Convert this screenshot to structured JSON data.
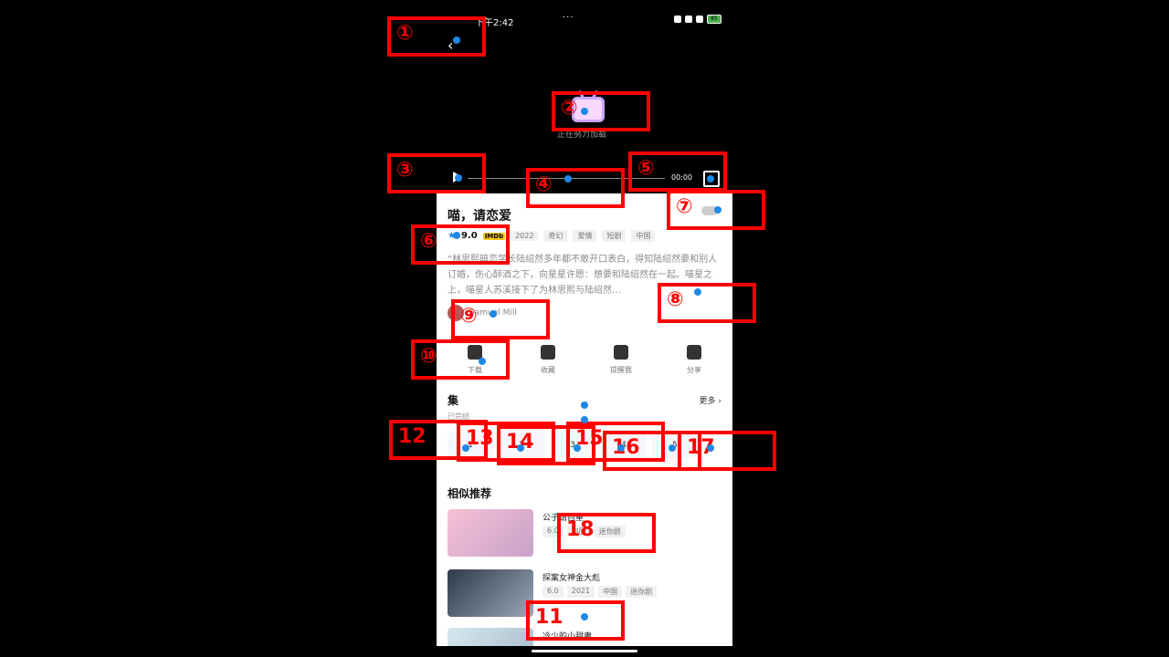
{
  "status": {
    "time": "下午2:42",
    "dots": "···",
    "battery": "85"
  },
  "player": {
    "loading_text": "正在努力加载",
    "time_total": "00:00"
  },
  "content": {
    "title": "喵，请恋爱",
    "rating": "9.0",
    "imdb": "IMDb",
    "tags": [
      "2022",
      "奇幻",
      "爱情",
      "短剧",
      "中国"
    ],
    "description": "“林思熙暗恋学长陆绍然多年都不敢开口表白，得知陆绍然要和别人订婚，伤心醉酒之下，向星星许愿：想要和陆绍然在一起。喵星之上，喵星人苏溪接下了为林思熙与陆绍然…",
    "actor": "Samuel Mill"
  },
  "actions": [
    {
      "label": "下载"
    },
    {
      "label": "收藏"
    },
    {
      "label": "提醒我"
    },
    {
      "label": "分享"
    }
  ],
  "episodes": {
    "title": "集",
    "subtitle": "已完结",
    "more": "更多",
    "items": [
      "1",
      "2",
      "3",
      "4",
      "5"
    ]
  },
  "recommendations": {
    "title": "相似推荐",
    "items": [
      {
        "name": "公子请自重",
        "tags": [
          "6.0",
          "中国",
          "迷你剧"
        ]
      },
      {
        "name": "探案女神金大彪",
        "tags": [
          "6.0",
          "2021",
          "中国",
          "迷你剧"
        ]
      },
      {
        "name": "冷少的小甜妻",
        "tags": []
      }
    ]
  },
  "annotations": [
    "①",
    "②",
    "③",
    "④",
    "⑤",
    "⑥",
    "⑦",
    "⑧",
    "⑨",
    "⑩",
    "11",
    "12",
    "13",
    "14",
    "15",
    "16",
    "17",
    "18"
  ]
}
